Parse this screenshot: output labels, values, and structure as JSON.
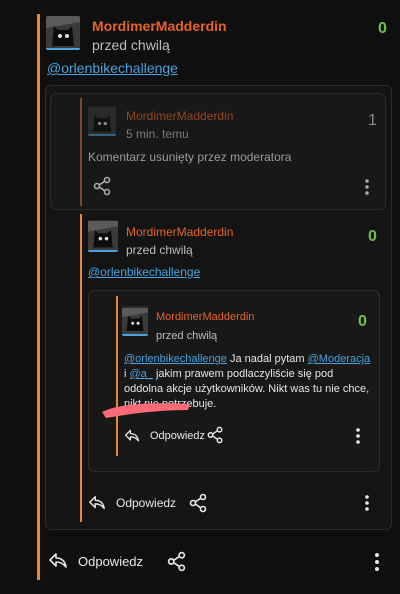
{
  "root": {
    "username": "MordimerMadderdin",
    "time": "przed chwilą",
    "vote": "0",
    "mention": "@orlenbikechallenge",
    "reply_label": "Odpowiedz"
  },
  "deleted": {
    "username": "MordimerMadderdin",
    "time": "5 min. temu",
    "vote": "1",
    "body": "Komentarz usunięty przez moderatora"
  },
  "reply1": {
    "username": "MordimerMadderdin",
    "time": "przed chwilą",
    "vote": "0",
    "mention": "@orlenbikechallenge",
    "reply_label": "Odpowiedz"
  },
  "reply2": {
    "username": "MordimerMadderdin",
    "time": "przed chwilą",
    "vote": "0",
    "mention1": "@orlenbikechallenge",
    "text1": " Ja nadal pytam ",
    "mention2": "@Moderacja",
    "text2": " i ",
    "mention3": "@a_",
    "text3": " jakim prawem podlaczyliście się pod oddolna akcje użytkowników. Nikt was tu nie chce, nikt nie potrzebuje.",
    "reply_label": "Odpowiedz"
  },
  "colors": {
    "accent": "#e8863a",
    "username": "#e4632a",
    "vote": "#6fbf4a",
    "link": "#4aa3df",
    "redaction": "#ff6a77"
  },
  "icons": [
    "reply-arrow-icon",
    "share-icon",
    "more-vertical-icon",
    "avatar-cat-icon"
  ]
}
